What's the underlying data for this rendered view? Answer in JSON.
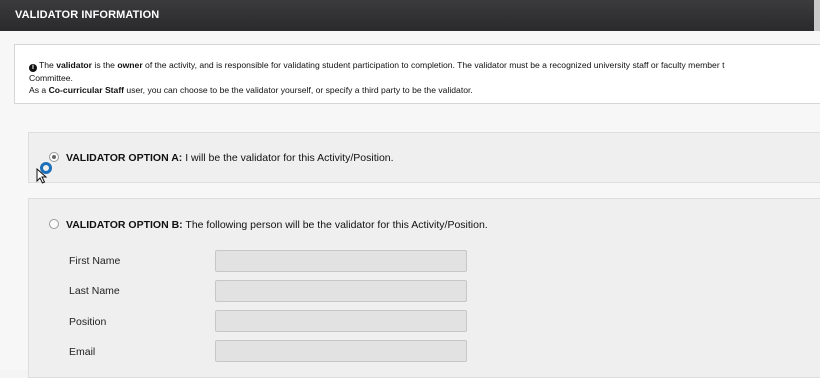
{
  "header": {
    "title": "VALIDATOR INFORMATION"
  },
  "info": {
    "icon": "info-icon",
    "line1_pre": "The ",
    "line1_bold1": "validator",
    "line1_mid": " is the ",
    "line1_bold2": "owner",
    "line1_post": " of the activity, and is responsible for validating student participation to completion. The validator must be a recognized university staff or faculty member t",
    "line2": "Committee.",
    "line3_pre": "As a ",
    "line3_bold": "Co-curricular Staff",
    "line3_post": " user, you can choose to be the validator yourself, or specify a third party to be the validator."
  },
  "option_a": {
    "label_bold": "VALIDATOR OPTION A:",
    "label_rest": " I will be the validator for this Activity/Position.",
    "checked": true
  },
  "option_b": {
    "label_bold": "VALIDATOR OPTION B:",
    "label_rest": " The following person will be the validator for this Activity/Position.",
    "checked": false,
    "fields": [
      {
        "label": "First Name",
        "value": ""
      },
      {
        "label": "Last Name",
        "value": ""
      },
      {
        "label": "Position",
        "value": ""
      },
      {
        "label": "Email",
        "value": ""
      }
    ]
  },
  "colors": {
    "header_bg": "#2f2f31",
    "cursor_ring": "#1e6fb9"
  }
}
